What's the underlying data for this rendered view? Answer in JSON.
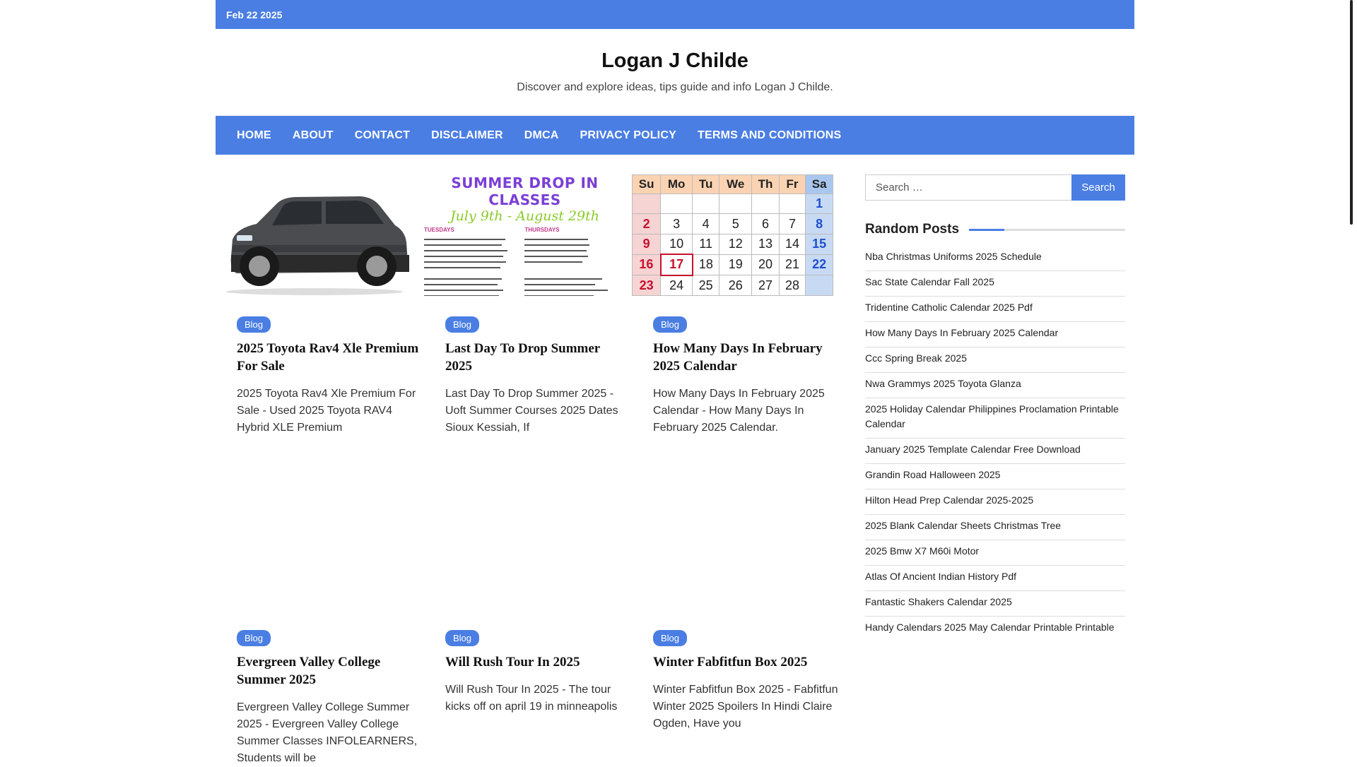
{
  "topbar": {
    "date": "Feb 22 2025"
  },
  "site": {
    "title": "Logan J Childe",
    "description": "Discover and explore ideas, tips guide and info Logan J Childe."
  },
  "nav": {
    "items": [
      {
        "label": "HOME"
      },
      {
        "label": "ABOUT"
      },
      {
        "label": "CONTACT"
      },
      {
        "label": "DISCLAIMER"
      },
      {
        "label": "DMCA"
      },
      {
        "label": "PRIVACY POLICY"
      },
      {
        "label": "TERMS AND CONDITIONS"
      }
    ]
  },
  "posts": [
    {
      "category": "Blog",
      "title": "2025 Toyota Rav4 Xle Premium For Sale",
      "excerpt": "2025 Toyota Rav4 Xle Premium For Sale - Used 2025 Toyota RAV4 Hybrid XLE Premium"
    },
    {
      "category": "Blog",
      "title": "Last Day To Drop Summer 2025",
      "excerpt": "Last Day To Drop Summer 2025 - Uoft Summer Courses 2025 Dates Sioux Kessiah, If",
      "image_text": {
        "headline": "SUMMER DROP IN CLASSES",
        "subhead": "July 9th - August 29th",
        "col1_head": "TUESDAYS",
        "col2_head": "THURSDAYS"
      }
    },
    {
      "category": "Blog",
      "title": "How Many Days In February 2025 Calendar",
      "excerpt": "How Many Days In February 2025 Calendar - How Many Days In February 2025 Calendar.",
      "calendar": {
        "days": [
          "Su",
          "Mo",
          "Tu",
          "We",
          "Th",
          "Fr",
          "Sa"
        ],
        "rows": [
          [
            "",
            "",
            "",
            "",
            "",
            "",
            "1"
          ],
          [
            "2",
            "3",
            "4",
            "5",
            "6",
            "7",
            "8"
          ],
          [
            "9",
            "10",
            "11",
            "12",
            "13",
            "14",
            "15"
          ],
          [
            "16",
            "17",
            "18",
            "19",
            "20",
            "21",
            "22"
          ],
          [
            "23",
            "24",
            "25",
            "26",
            "27",
            "28",
            ""
          ]
        ],
        "highlight": "17"
      }
    },
    {
      "category": "Blog",
      "title": "Evergreen Valley College Summer 2025",
      "excerpt": "Evergreen Valley College Summer 2025 - Evergreen Valley College Summer Classes INFOLEARNERS, Students will be"
    },
    {
      "category": "Blog",
      "title": "Will Rush Tour In 2025",
      "excerpt": "Will Rush Tour In 2025 - The tour kicks off on april 19 in minneapolis"
    },
    {
      "category": "Blog",
      "title": "Winter Fabfitfun Box 2025",
      "excerpt": "Winter Fabfitfun Box 2025 - Fabfitfun Winter 2025 Spoilers In Hindi Claire Ogden, Have you"
    }
  ],
  "sidebar": {
    "search_placeholder": "Search …",
    "search_button": "Search",
    "random_posts_title": "Random Posts",
    "random_posts": [
      "Nba Christmas Uniforms 2025 Schedule",
      "Sac State Calendar Fall 2025",
      "Tridentine Catholic Calendar 2025 Pdf",
      "How Many Days In February 2025 Calendar",
      "Ccc Spring Break 2025",
      "Nwa Grammys 2025 Toyota Glanza",
      "2025 Holiday Calendar Philippines Proclamation Printable Calendar",
      "January 2025 Template Calendar Free Download",
      "Grandin Road Halloween 2025",
      "Hilton Head Prep Calendar 2025-2025",
      "2025 Blank Calendar Sheets Christmas Tree",
      "2025 Bmw X7 M60i Motor",
      "Atlas Of Ancient Indian History Pdf",
      "Fantastic Shakers Calendar 2025",
      "Handy Calendars 2025 May Calendar Printable Printable"
    ]
  },
  "colors": {
    "accent": "#4a7ee3",
    "calendar_red": "#c8102e",
    "calendar_sat": "#1e4fd0"
  },
  "icons": {
    "post_1_image": "suv-car-image"
  }
}
